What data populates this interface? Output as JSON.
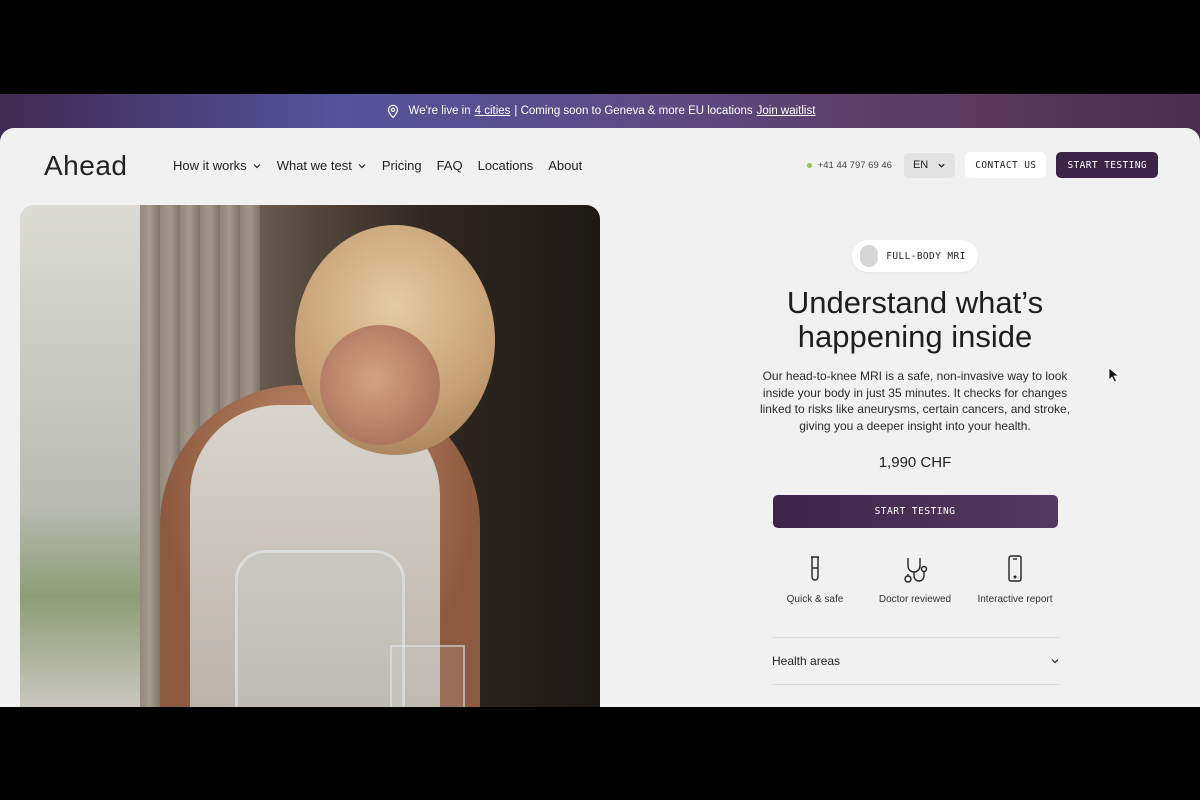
{
  "banner": {
    "prefix": "We're live in",
    "cities_link": "4 cities",
    "middle": "| Coming soon to Geneva & more EU locations",
    "waitlist_link": "Join waitlist"
  },
  "nav": {
    "logo": "Ahead",
    "items": [
      {
        "label": "How it works",
        "dropdown": true
      },
      {
        "label": "What we test",
        "dropdown": true
      },
      {
        "label": "Pricing",
        "dropdown": false
      },
      {
        "label": "FAQ",
        "dropdown": false
      },
      {
        "label": "Locations",
        "dropdown": false
      },
      {
        "label": "About",
        "dropdown": false
      }
    ],
    "phone": "+41 44 797 69 46",
    "language": "EN",
    "contact_label": "CONTACT US",
    "start_label": "START TESTING"
  },
  "hero": {
    "badge": "FULL-BODY MRI",
    "title_line1": "Understand what’s",
    "title_line2": "happening inside",
    "description": "Our head-to-knee MRI is a safe, non-invasive way to look inside your body in just 35 minutes. It checks for changes linked to risks like aneurysms, certain cancers, and stroke, giving you a deeper insight into your health.",
    "price": "1,990 CHF",
    "cta_label": "START TESTING",
    "features": [
      {
        "icon": "test-tube-icon",
        "label": "Quick & safe"
      },
      {
        "icon": "stethoscope-icon",
        "label": "Doctor reviewed"
      },
      {
        "icon": "phone-icon",
        "label": "Interactive report"
      }
    ],
    "accordion_label": "Health areas"
  },
  "colors": {
    "primary": "#3c2446",
    "status_dot": "#9ac14f",
    "page_bg": "#f1f1f1"
  }
}
